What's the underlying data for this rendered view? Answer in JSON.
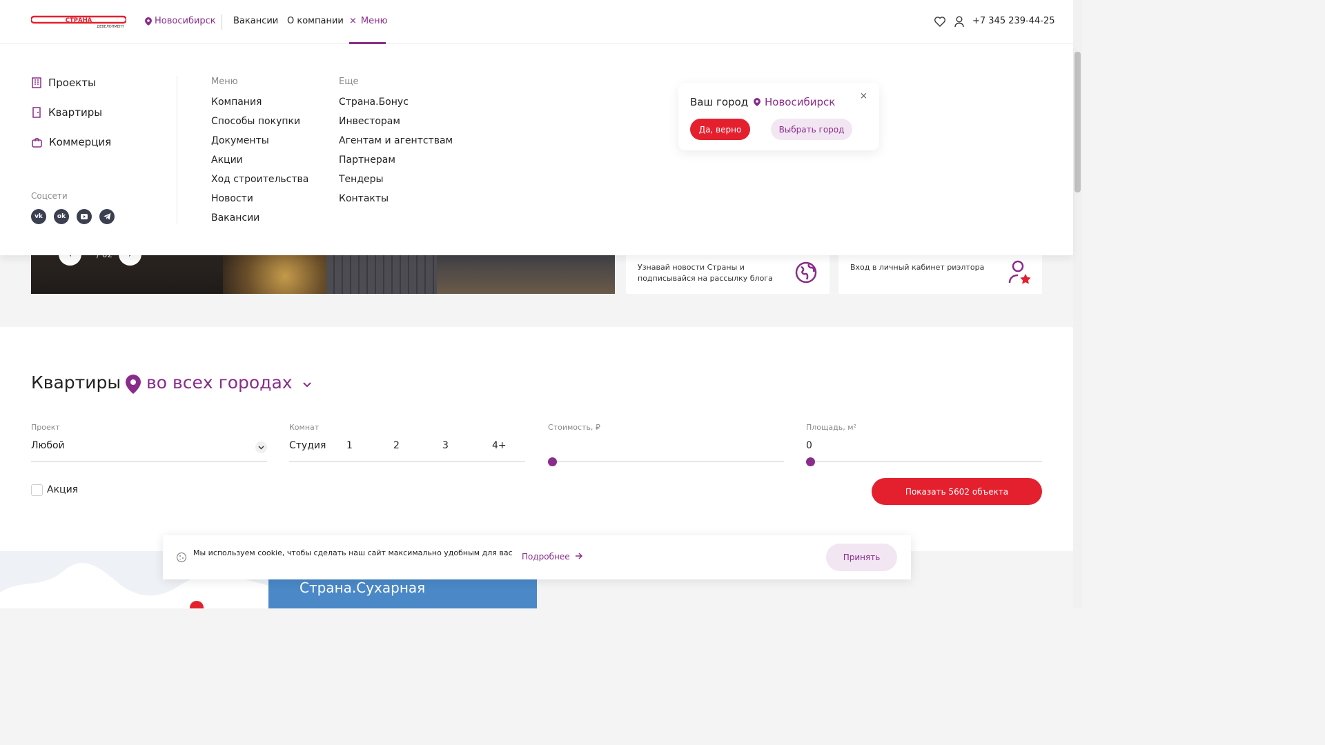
{
  "header": {
    "logo_text": "СТРАНА",
    "logo_sub": "ДЕВЕЛОПМЕНТ",
    "city": "Новосибирск",
    "nav": [
      "Вакансии",
      "О компании"
    ],
    "menu_label": "Меню",
    "phone": "+7 345 239-44-25",
    "close_glyph": "×"
  },
  "mega": {
    "side": [
      "Проекты",
      "Квартиры",
      "Коммерция"
    ],
    "social_label": "Соцсети",
    "social": [
      "vk",
      "ok",
      "yt",
      "tg"
    ],
    "col1_title": "Меню",
    "col1": [
      "Компания",
      "Способы покупки",
      "Документы",
      "Акции",
      "Ход строительства",
      "Новости",
      "Вакансии"
    ],
    "col2_title": "Еще",
    "col2": [
      "Страна.Бонус",
      "Инвесторам",
      "Агентам и агентствам",
      "Партнерам",
      "Тендеры",
      "Контакты"
    ]
  },
  "city_popup": {
    "title": "Ваш город",
    "city": "Новосибирск",
    "close": "×",
    "yes": "Да, верно",
    "choose": "Выбрать город"
  },
  "banner": {
    "slide_counter": "/ 02",
    "prev": "‹",
    "next": "›"
  },
  "cards": [
    {
      "text": "Узнавай новости Страны и подписывайся на рассылку блога"
    },
    {
      "text": "Вход в личный кабинет риэлтора"
    }
  ],
  "filters": {
    "title": "Квартиры",
    "city_sel": "во всех городах",
    "project_label": "Проект",
    "project_value": "Любой",
    "rooms_label": "Комнат",
    "rooms": [
      "Студия",
      "1",
      "2",
      "3",
      "4+"
    ],
    "cost_label": "Стоимость, ₽",
    "area_label": "Площадь, м²",
    "area_value": "0",
    "promo_label": "Акция",
    "show_button": "Показать 5602 объекта"
  },
  "bottom": {
    "project_title": "Страна.Сухарная"
  },
  "cookie": {
    "text": "Мы используем cookie, чтобы сделать наш сайт максимально удобным для вас",
    "more": "Подробнее",
    "accept": "Принять"
  }
}
